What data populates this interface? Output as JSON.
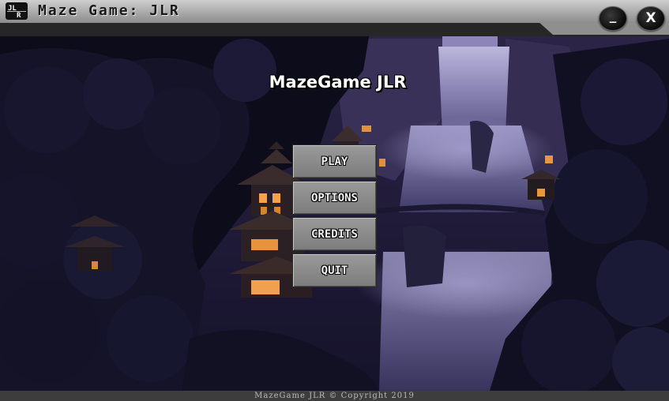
{
  "window": {
    "logo_text": "JLR",
    "title": "Maze Game: JLR",
    "minimize_label": "_",
    "close_label": "X"
  },
  "game": {
    "title": "MazeGame JLR",
    "menu": [
      {
        "label": "PLAY"
      },
      {
        "label": "OPTIONS"
      },
      {
        "label": "CREDITS"
      },
      {
        "label": "QUIT"
      }
    ]
  },
  "footer": {
    "copyright": "MazeGame JLR © Copyright 2019"
  },
  "colors": {
    "sky": "#2a2447",
    "waterfall": "#8e88b8",
    "window_light": "#f2a24a",
    "titlebar": "#a9a9a9",
    "footer": "#3d3d3d"
  }
}
